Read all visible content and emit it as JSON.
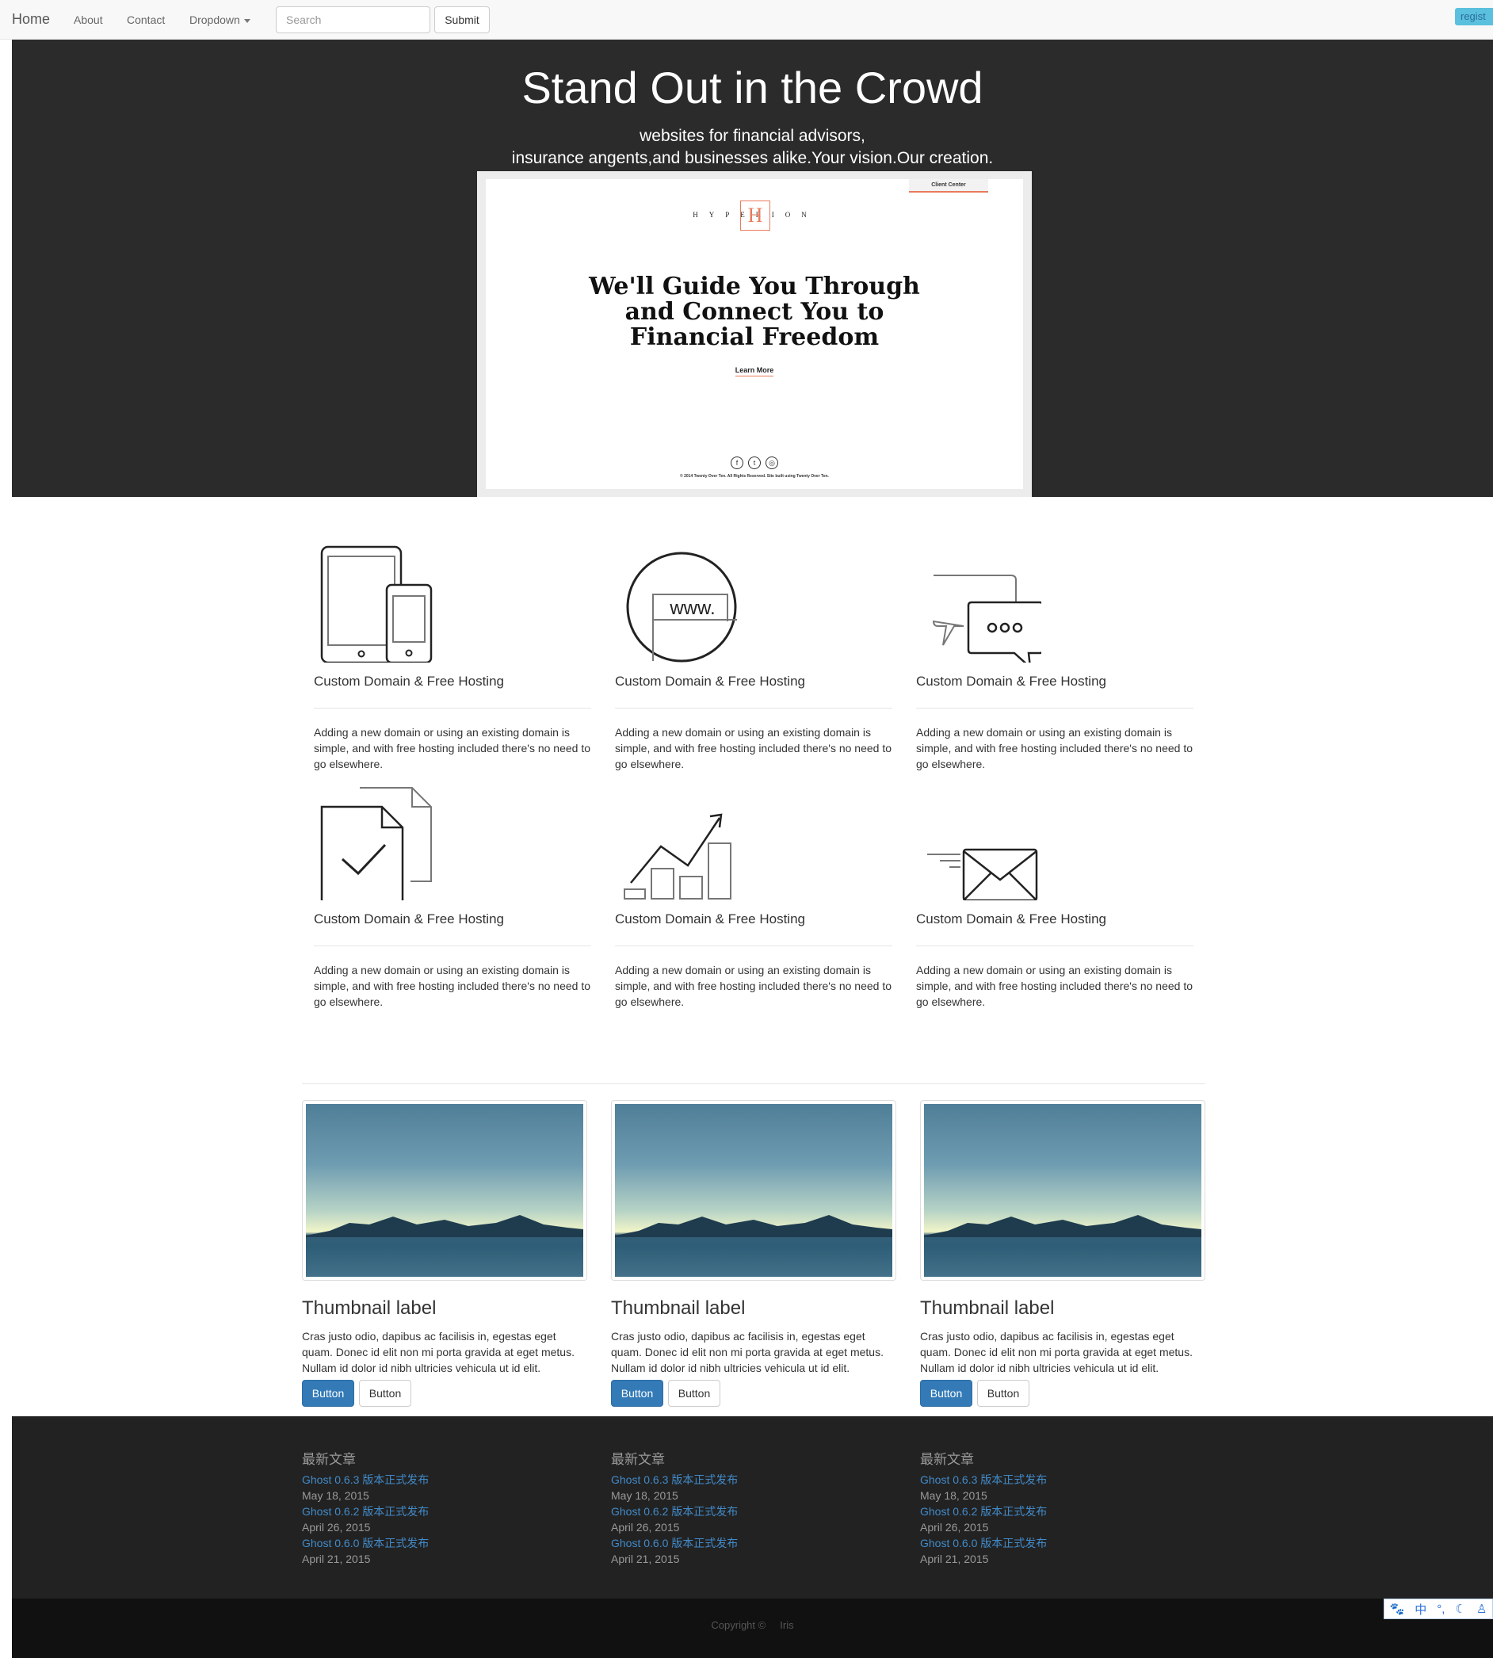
{
  "navbar": {
    "brand": "Home",
    "links": [
      "About",
      "Contact",
      "Dropdown"
    ],
    "search_placeholder": "Search",
    "submit_label": "Submit",
    "register_label": "regist"
  },
  "hero": {
    "title": "Stand Out in the Crowd",
    "subtitle_line1": "websites for financial advisors,",
    "subtitle_line2": "insurance angents,and businesses alike.Your vision.Our creation.",
    "preview": {
      "client_tab": "Client Center",
      "logo_text": "HYPERION",
      "logo_letter": "H",
      "heading_line1": "We'll Guide You Through",
      "heading_line2": "and Connect You to",
      "heading_line3": "Financial Freedom",
      "learn_more": "Learn More",
      "footer_text": "© 2014 Twenty Over Ten. All Rights Reserved. Site built using Twenty Over Ten."
    }
  },
  "features": [
    {
      "icon": "devices-icon",
      "title": "Custom Domain & Free Hosting",
      "desc": "Adding a new domain or using an existing domain is simple, and with free hosting included there's no need to go elsewhere."
    },
    {
      "icon": "www-globe-icon",
      "title": "Custom Domain & Free Hosting",
      "desc": "Adding a new domain or using an existing domain is simple, and with free hosting included there's no need to go elsewhere."
    },
    {
      "icon": "chat-bubbles-icon",
      "title": "Custom Domain & Free Hosting",
      "desc": "Adding a new domain or using an existing domain is simple, and with free hosting included there's no need to go elsewhere."
    },
    {
      "icon": "document-check-icon",
      "title": "Custom Domain & Free Hosting",
      "desc": "Adding a new domain or using an existing domain is simple, and with free hosting included there's no need to go elsewhere."
    },
    {
      "icon": "growth-chart-icon",
      "title": "Custom Domain & Free Hosting",
      "desc": "Adding a new domain or using an existing domain is simple, and with free hosting included there's no need to go elsewhere."
    },
    {
      "icon": "envelope-icon",
      "title": "Custom Domain & Free Hosting",
      "desc": "Adding a new domain or using an existing domain is simple, and with free hosting included there's no need to go elsewhere."
    }
  ],
  "thumbnails": [
    {
      "label": "Thumbnail label",
      "text": "Cras justo odio, dapibus ac facilisis in, egestas eget quam. Donec id elit non mi porta gravida at eget metus. Nullam id dolor id nibh ultricies vehicula ut id elit.",
      "primary_button": "Button",
      "default_button": "Button"
    },
    {
      "label": "Thumbnail label",
      "text": "Cras justo odio, dapibus ac facilisis in, egestas eget quam. Donec id elit non mi porta gravida at eget metus. Nullam id dolor id nibh ultricies vehicula ut id elit.",
      "primary_button": "Button",
      "default_button": "Button"
    },
    {
      "label": "Thumbnail label",
      "text": "Cras justo odio, dapibus ac facilisis in, egestas eget quam. Donec id elit non mi porta gravida at eget metus. Nullam id dolor id nibh ultricies vehicula ut id elit.",
      "primary_button": "Button",
      "default_button": "Button"
    }
  ],
  "footer": {
    "columns": [
      {
        "heading": "最新文章",
        "posts": [
          {
            "title": "Ghost 0.6.3 版本正式发布",
            "date": "May 18, 2015"
          },
          {
            "title": "Ghost 0.6.2 版本正式发布",
            "date": "April 26, 2015"
          },
          {
            "title": "Ghost 0.6.0 版本正式发布",
            "date": "April 21, 2015"
          }
        ]
      },
      {
        "heading": "最新文章",
        "posts": [
          {
            "title": "Ghost 0.6.3 版本正式发布",
            "date": "May 18, 2015"
          },
          {
            "title": "Ghost 0.6.2 版本正式发布",
            "date": "April 26, 2015"
          },
          {
            "title": "Ghost 0.6.0 版本正式发布",
            "date": "April 21, 2015"
          }
        ]
      },
      {
        "heading": "最新文章",
        "posts": [
          {
            "title": "Ghost 0.6.3 版本正式发布",
            "date": "May 18, 2015"
          },
          {
            "title": "Ghost 0.6.2 版本正式发布",
            "date": "April 26, 2015"
          },
          {
            "title": "Ghost 0.6.0 版本正式发布",
            "date": "April 21, 2015"
          }
        ]
      }
    ],
    "copyright": "Copyright ©     Iris"
  },
  "ime_toolbar": [
    "paw-icon",
    "中",
    "°,",
    "moon-icon",
    "person-icon"
  ],
  "colors": {
    "hero_bg": "#2b2b2b",
    "primary": "#337ab7",
    "link": "#428bca",
    "accent": "#e97b5c",
    "register": "#5bc0de"
  }
}
